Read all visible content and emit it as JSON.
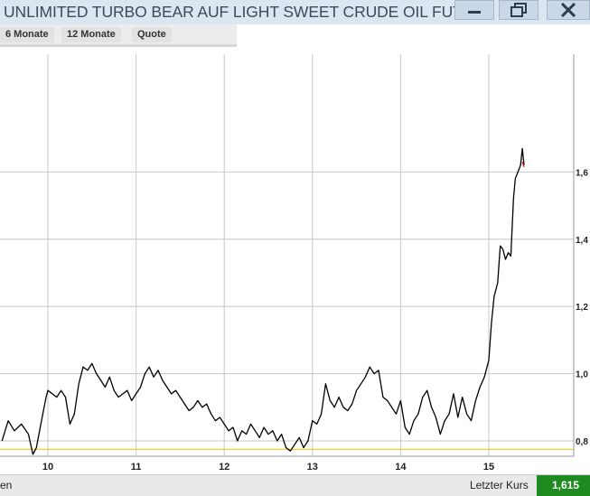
{
  "window": {
    "title": "UNLIMITED TURBO BEAR AUF LIGHT SWEET CRUDE OIL FUT...",
    "minimize_icon": "minimize-icon",
    "maximize_icon": "restore-icon",
    "close_icon": "close-icon"
  },
  "tabs": [
    {
      "label": "6 Monate"
    },
    {
      "label": "12 Monate"
    },
    {
      "label": "Quote"
    }
  ],
  "footer": {
    "left_fragment": "en",
    "last_price_label": "Letzter Kurs",
    "last_price_value": "1,615",
    "last_price_color": "#1f8a1f"
  },
  "chart_data": {
    "type": "line",
    "x_ticks": [
      "10",
      "11",
      "12",
      "13",
      "14",
      "15"
    ],
    "y_ticks": [
      "0,8",
      "1,0",
      "1,2",
      "1,4",
      "1,6"
    ],
    "ylim": [
      0.6,
      1.7
    ],
    "grid": true,
    "reference_line": {
      "value": 0.775,
      "color": "#e0c400"
    },
    "series": [
      {
        "color": "#000000",
        "x": [
          9.48,
          9.55,
          9.62,
          9.7,
          9.78,
          9.83,
          9.87,
          9.92,
          9.98,
          10.0,
          10.05,
          10.1,
          10.15,
          10.2,
          10.25,
          10.3,
          10.35,
          10.4,
          10.45,
          10.5,
          10.55,
          10.6,
          10.65,
          10.7,
          10.75,
          10.8,
          10.85,
          10.9,
          10.95,
          11.0,
          11.05,
          11.1,
          11.15,
          11.2,
          11.25,
          11.3,
          11.35,
          11.4,
          11.45,
          11.5,
          11.55,
          11.6,
          11.65,
          11.7,
          11.75,
          11.8,
          11.85,
          11.9,
          11.95,
          12.0,
          12.05,
          12.1,
          12.15,
          12.2,
          12.25,
          12.3,
          12.35,
          12.4,
          12.45,
          12.5,
          12.55,
          12.6,
          12.65,
          12.7,
          12.75,
          12.8,
          12.85,
          12.9,
          12.95,
          13.0,
          13.05,
          13.1,
          13.15,
          13.2,
          13.25,
          13.3,
          13.35,
          13.4,
          13.45,
          13.5,
          13.55,
          13.6,
          13.65,
          13.7,
          13.75,
          13.8,
          13.85,
          13.9,
          13.95,
          14.0,
          14.05,
          14.1,
          14.15,
          14.2,
          14.25,
          14.3,
          14.35,
          14.4,
          14.45,
          14.5,
          14.55,
          14.6,
          14.65,
          14.7,
          14.75,
          14.8,
          14.85,
          14.9,
          14.95,
          15.0,
          15.03,
          15.06,
          15.1,
          15.13,
          15.16,
          15.19,
          15.22,
          15.25,
          15.28,
          15.3,
          15.33,
          15.36,
          15.38,
          15.4
        ],
        "y": [
          0.8,
          0.86,
          0.83,
          0.85,
          0.82,
          0.76,
          0.78,
          0.85,
          0.93,
          0.95,
          0.94,
          0.93,
          0.95,
          0.93,
          0.85,
          0.88,
          0.97,
          1.02,
          1.01,
          1.03,
          1.0,
          0.98,
          0.96,
          0.99,
          0.95,
          0.93,
          0.94,
          0.95,
          0.92,
          0.94,
          0.96,
          1.0,
          1.02,
          0.99,
          1.01,
          0.98,
          0.96,
          0.94,
          0.95,
          0.93,
          0.91,
          0.89,
          0.9,
          0.92,
          0.9,
          0.91,
          0.88,
          0.86,
          0.87,
          0.85,
          0.83,
          0.84,
          0.8,
          0.83,
          0.82,
          0.85,
          0.83,
          0.81,
          0.84,
          0.82,
          0.83,
          0.8,
          0.82,
          0.78,
          0.77,
          0.79,
          0.81,
          0.78,
          0.8,
          0.86,
          0.85,
          0.88,
          0.97,
          0.92,
          0.9,
          0.93,
          0.9,
          0.89,
          0.91,
          0.95,
          0.97,
          0.99,
          1.02,
          1.0,
          1.01,
          0.93,
          0.92,
          0.9,
          0.88,
          0.92,
          0.84,
          0.82,
          0.86,
          0.88,
          0.93,
          0.95,
          0.9,
          0.87,
          0.82,
          0.86,
          0.88,
          0.94,
          0.87,
          0.93,
          0.88,
          0.86,
          0.92,
          0.96,
          0.99,
          1.04,
          1.15,
          1.23,
          1.27,
          1.38,
          1.37,
          1.34,
          1.36,
          1.35,
          1.52,
          1.58,
          1.6,
          1.62,
          1.67,
          1.62
        ]
      },
      {
        "color": "#d42020",
        "x": [
          15.38,
          15.4
        ],
        "y": [
          1.63,
          1.615
        ]
      }
    ]
  }
}
